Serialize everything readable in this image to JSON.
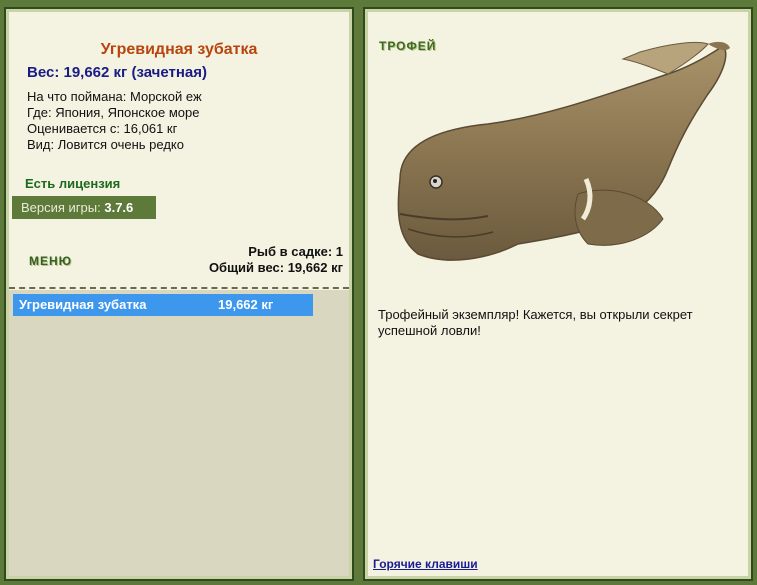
{
  "fish": {
    "name": "Угревидная зубатка",
    "weight_line": "Вес: 19,662 кг (зачетная)",
    "bait": "На что поймана: Морской еж",
    "location": "Где: Япония, Японское море",
    "valued": "Оценивается с: 16,061 кг",
    "rarity": "Вид: Ловится очень редко"
  },
  "license": "Есть лицензия",
  "version": {
    "label": "Версия игры:",
    "value": "3.7.6"
  },
  "menu_label": "МЕНЮ",
  "stats": {
    "count_line": "Рыб в садке: 1",
    "total_line": "Общий вес: 19,662 кг"
  },
  "catch_list": [
    {
      "name": "Угревидная зубатка",
      "weight": "19,662 кг"
    }
  ],
  "trophy": {
    "title": "ТРОФЕЙ",
    "text": "Трофейный экземпляр! Кажется, вы открыли секрет успешной ловли!"
  },
  "hotkeys_label": "Горячие клавиши"
}
